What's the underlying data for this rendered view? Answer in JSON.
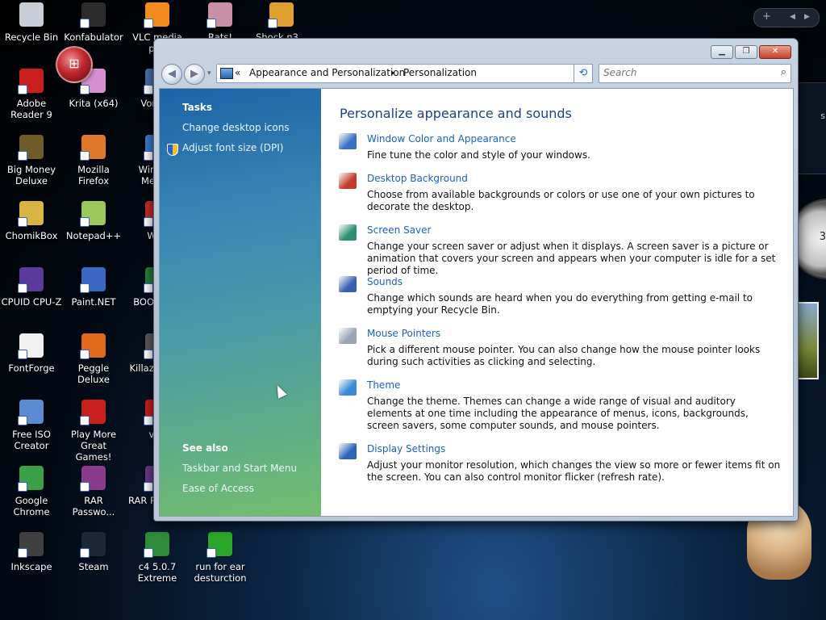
{
  "desktop": {
    "icons": [
      {
        "label": "Recycle Bin",
        "color": "#c9ced6",
        "shortcut": false
      },
      {
        "label": "Konfabulator",
        "color": "#2c2c2c",
        "shortcut": true
      },
      {
        "label": "VLC media pl...",
        "color": "#f28b1e",
        "shortcut": true
      },
      {
        "label": "Rats!",
        "color": "#c88fa6",
        "shortcut": true
      },
      {
        "label": "Shock n3...",
        "color": "#e0a030",
        "shortcut": true
      },
      {
        "label": "Adobe Reader 9",
        "color": "#c81e1e",
        "shortcut": true
      },
      {
        "label": "Krita (x64)",
        "color": "#d68fd0",
        "shortcut": true
      },
      {
        "label": "Vorte...",
        "color": "#4a6fa8",
        "shortcut": true
      },
      {
        "label": "Big Money Deluxe",
        "color": "#6f5a2a",
        "shortcut": true
      },
      {
        "label": "Mozilla Firefox",
        "color": "#e0782a",
        "shortcut": true
      },
      {
        "label": "Windo... Mess...",
        "color": "#3a7cc7",
        "shortcut": true
      },
      {
        "label": "ChomikBox",
        "color": "#d8b445",
        "shortcut": true
      },
      {
        "label": "Notepad++",
        "color": "#9ac85a",
        "shortcut": true
      },
      {
        "label": "Wi...",
        "color": "#c42a2a",
        "shortcut": true
      },
      {
        "label": "CPUID CPU-Z",
        "color": "#5a3a9a",
        "shortcut": true
      },
      {
        "label": "Paint.NET",
        "color": "#3a68c0",
        "shortcut": true
      },
      {
        "label": "BOO... N...",
        "color": "#2a7a3a",
        "shortcut": true
      },
      {
        "label": "FontForge",
        "color": "#f0f0f0",
        "shortcut": true
      },
      {
        "label": "Peggle Deluxe",
        "color": "#e06a1a",
        "shortcut": true
      },
      {
        "label": "Killaz MPE...",
        "color": "#5a5a5a",
        "shortcut": true
      },
      {
        "label": "Free ISO Creator",
        "color": "#5a8ad0",
        "shortcut": true
      },
      {
        "label": "Play More Great Games!",
        "color": "#c81e1e",
        "shortcut": true
      },
      {
        "label": "vi...",
        "color": "#c81e1e",
        "shortcut": true
      },
      {
        "label": "Google Chrome",
        "color": "#3aa04a",
        "shortcut": true
      },
      {
        "label": "RAR Passwo...",
        "color": "#8a3a8a",
        "shortcut": true
      },
      {
        "label": "RAR R... To...",
        "color": "#6a3a8a",
        "shortcut": true
      },
      {
        "label": "Inkscape",
        "color": "#404040",
        "shortcut": true
      },
      {
        "label": "Steam",
        "color": "#1b2838",
        "shortcut": true
      },
      {
        "label": "c4 5.0.7 Extreme",
        "color": "#2f8a3a",
        "shortcut": true
      },
      {
        "label": "run for ear desturction",
        "color": "#2aa52a",
        "shortcut": true
      }
    ],
    "gadget_controls": {
      "add": "+",
      "prev": "◀",
      "next": "▶"
    },
    "gadget_side_text": "s",
    "clock_text": "3"
  },
  "window": {
    "controls": {
      "minimize": "▁",
      "maximize": "❐",
      "close": "✕"
    },
    "nav": {
      "back": "◀",
      "forward": "▶",
      "history": "▾"
    },
    "breadcrumb": {
      "chevron": "«",
      "parts": [
        "Appearance and Personalization",
        "Personalization"
      ],
      "separator": "▸",
      "dropdown": "▼"
    },
    "refresh_icon": "⟲",
    "search": {
      "placeholder": "Search",
      "icon": "search-icon"
    },
    "tasks": {
      "heading": "Tasks",
      "links": [
        "Change desktop icons",
        "Adjust font size (DPI)"
      ]
    },
    "see_also": {
      "heading": "See also",
      "links": [
        "Taskbar and Start Menu",
        "Ease of Access"
      ]
    },
    "main": {
      "title": "Personalize appearance and sounds",
      "items": [
        {
          "title": "Window Color and Appearance",
          "desc": "Fine tune the color and style of your windows.",
          "icon": "window-color-icon"
        },
        {
          "title": "Desktop Background",
          "desc": "Choose from available backgrounds or colors or use one of your own pictures to decorate the desktop.",
          "icon": "desktop-background-icon"
        },
        {
          "title": "Screen Saver",
          "desc": "Change your screen saver or adjust when it displays. A screen saver is a picture or animation that covers your screen and appears when your computer is idle for a set period of time.",
          "icon": "screen-saver-icon"
        },
        {
          "title": "Sounds",
          "desc": "Change which sounds are heard when you do everything from getting e-mail to emptying your Recycle Bin.",
          "icon": "sounds-icon"
        },
        {
          "title": "Mouse Pointers",
          "desc": "Pick a different mouse pointer. You can also change how the mouse pointer looks during such activities as clicking and selecting.",
          "icon": "mouse-pointers-icon"
        },
        {
          "title": "Theme",
          "desc": "Change the theme. Themes can change a wide range of visual and auditory elements at one time including the appearance of menus, icons, backgrounds, screen savers, some computer sounds, and mouse pointers.",
          "icon": "theme-icon"
        },
        {
          "title": "Display Settings",
          "desc": "Adjust your monitor resolution, which changes the view so more or fewer items fit on the screen. You can also control monitor flicker (refresh rate).",
          "icon": "display-settings-icon"
        }
      ]
    }
  }
}
